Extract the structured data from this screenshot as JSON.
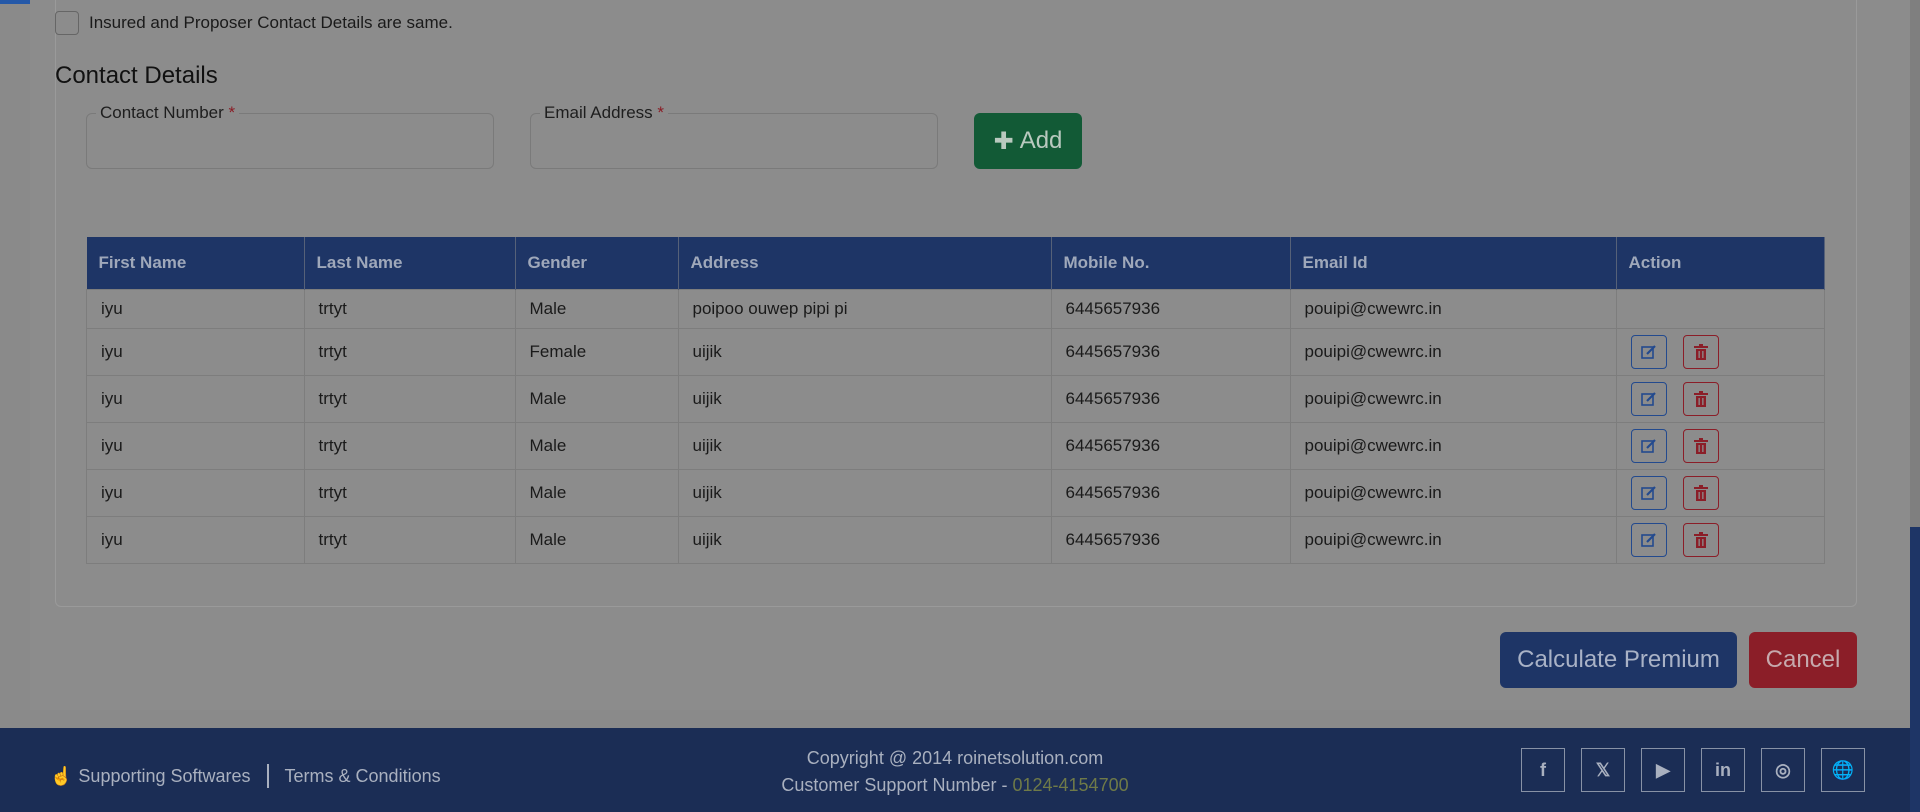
{
  "form": {
    "same_contact_label": "Insured and Proposer Contact Details are same.",
    "section_title": "Contact Details",
    "contact_number_label": "Contact Number",
    "email_label": "Email Address",
    "required_mark": "*",
    "contact_number_value": "",
    "email_value": "",
    "add_label": "Add"
  },
  "table": {
    "headers": [
      "First Name",
      "Last Name",
      "Gender",
      "Address",
      "Mobile No.",
      "Email Id",
      "Action"
    ],
    "rows": [
      [
        "iyu",
        "trtyt",
        "Male",
        "poipoo ouwep pipi pi",
        "6445657936",
        "pouipi@cwewrc.in"
      ],
      [
        "iyu",
        "trtyt",
        "Female",
        "uijik",
        "6445657936",
        "pouipi@cwewrc.in"
      ],
      [
        "iyu",
        "trtyt",
        "Male",
        "uijik",
        "6445657936",
        "pouipi@cwewrc.in"
      ],
      [
        "iyu",
        "trtyt",
        "Male",
        "uijik",
        "6445657936",
        "pouipi@cwewrc.in"
      ],
      [
        "iyu",
        "trtyt",
        "Male",
        "uijik",
        "6445657936",
        "pouipi@cwewrc.in"
      ],
      [
        "iyu",
        "trtyt",
        "Male",
        "uijik",
        "6445657936",
        "pouipi@cwewrc.in"
      ]
    ]
  },
  "actions": {
    "calculate_label": "Calculate Premium",
    "cancel_label": "Cancel"
  },
  "footer": {
    "supporting_label": "Supporting Softwares",
    "terms_label": "Terms & Conditions",
    "copyright": "Copyright @ 2014 roinetsolution.com",
    "support_prefix": "Customer Support Number - ",
    "support_number": "0124-4154700",
    "socials": [
      "facebook-icon",
      "x-icon",
      "youtube-icon",
      "linkedin-icon",
      "instagram-icon",
      "globe-icon"
    ]
  },
  "colors": {
    "header_navy": "#1e3566",
    "add_green": "#125a36",
    "cancel_red": "#8b1e28",
    "footer_bg": "#1b2d55"
  }
}
